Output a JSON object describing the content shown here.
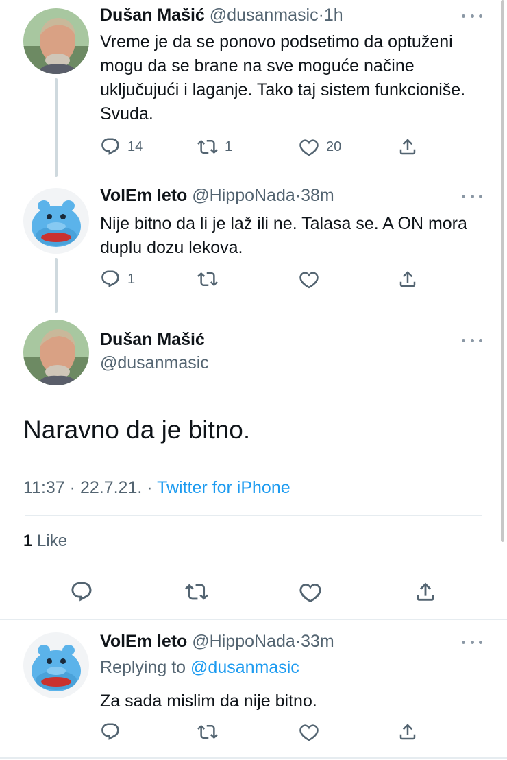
{
  "tweet1": {
    "display_name": "Dušan Mašić",
    "handle": "@dusanmasic",
    "sep": "·",
    "time": "1h",
    "text": "Vreme je da se ponovo podsetimo da optuženi mogu da se brane na sve moguće načine uključujući i laganje. Tako taj sistem funkcioniše. Svuda.",
    "replies": "14",
    "retweets": "1",
    "likes": "20"
  },
  "tweet2": {
    "display_name": "VolEm leto",
    "handle": "@HippoNada",
    "sep": "·",
    "time": "38m",
    "text": "Nije bitno da li je laž ili ne. Talasa se. A ON mora duplu dozu lekova.",
    "replies": "1",
    "retweets": "",
    "likes": ""
  },
  "main_tweet": {
    "display_name": "Dušan Mašić",
    "handle": "@dusanmasic",
    "text": "Naravno da je bitno.",
    "time": "11:37",
    "sep1": "·",
    "date": "22.7.21.",
    "sep2": "·",
    "source": "Twitter for iPhone",
    "like_count": "1",
    "like_label": "Like"
  },
  "reply": {
    "display_name": "VolEm leto",
    "handle": "@HippoNada",
    "sep": "·",
    "time": "33m",
    "replying_prefix": "Replying to",
    "replying_to": "@dusanmasic",
    "text": "Za sada mislim da nije bitno."
  },
  "icons": {
    "reply": "reply-icon",
    "retweet": "retweet-icon",
    "like": "heart-icon",
    "share": "share-icon",
    "more": "more-dots-icon"
  },
  "colors": {
    "text": "#0f1419",
    "muted": "#536471",
    "link": "#1d9bf0",
    "divider": "#e6ecf0"
  }
}
